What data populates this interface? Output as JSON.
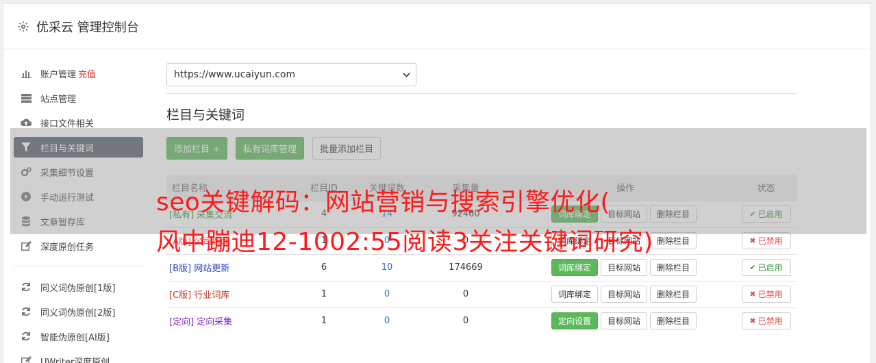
{
  "header": {
    "title": "优采云 管理控制台"
  },
  "sidebar": {
    "group1": [
      {
        "label": "账户管理",
        "extra": "充值",
        "icon": "bar-chart-icon"
      },
      {
        "label": "站点管理",
        "icon": "server-icon"
      },
      {
        "label": "接口文件相关",
        "icon": "cloud-upload-icon"
      },
      {
        "label": "栏目与关键词",
        "icon": "filter-icon",
        "active": true
      },
      {
        "label": "采集细节设置",
        "icon": "cogs-icon"
      },
      {
        "label": "手动运行测试",
        "icon": "play-icon"
      },
      {
        "label": "文章暂存库",
        "icon": "database-icon"
      },
      {
        "label": "深度原创任务",
        "icon": "edit-icon"
      }
    ],
    "group2": [
      {
        "label": "同义词伪原创[1版]",
        "icon": "refresh-icon"
      },
      {
        "label": "同义词伪原创[2版]",
        "icon": "refresh-icon"
      },
      {
        "label": "智能伪原创[AI版]",
        "icon": "refresh-icon"
      },
      {
        "label": "UWriter深度原创",
        "icon": "edit-icon"
      }
    ]
  },
  "main": {
    "site_select": "https://www.ucaiyun.com",
    "section_title": "栏目与关键词",
    "buttons": {
      "add_column": "添加栏目 +",
      "private_lib": "私有词库管理",
      "batch_add": "批量添加栏目"
    },
    "table": {
      "headers": [
        "栏目名称",
        "栏目ID",
        "关键词数",
        "采集量",
        "操作",
        "状态"
      ],
      "rows": [
        {
          "tag": "[私有]",
          "name": "采集交流",
          "id": "4",
          "kw": "14",
          "count": "92460",
          "bind": "词库绑定",
          "target": "目标网站",
          "del": "删除栏目",
          "status": "已启用"
        },
        {
          "tag": "[A版]",
          "name": "公司新闻",
          "id": "1",
          "kw": "0",
          "count": "0",
          "bind": "词库绑定",
          "target": "目标网站",
          "del": "删除栏目",
          "status": "已禁用"
        },
        {
          "tag": "[B版]",
          "name": "网站更新",
          "id": "6",
          "kw": "10",
          "count": "174669",
          "bind": "词库绑定",
          "target": "目标网站",
          "del": "删除栏目",
          "status": "已启用"
        },
        {
          "tag": "[C版]",
          "name": "行业词库",
          "id": "1",
          "kw": "0",
          "count": "0",
          "bind": "词库绑定",
          "target": "目标网站",
          "del": "删除栏目",
          "status": "已禁用"
        },
        {
          "tag": "[定向]",
          "name": "定向采集",
          "id": "1",
          "kw": "0",
          "count": "0",
          "bind": "定向设置",
          "target": "目标网站",
          "del": "删除栏目",
          "status": "已禁用"
        }
      ]
    }
  },
  "overlay": {
    "line1": "seo关键解码：网站营销与搜索引擎优化(",
    "line2": "风中蹦迪12-1002:55阅读3关注关键词研究)"
  }
}
